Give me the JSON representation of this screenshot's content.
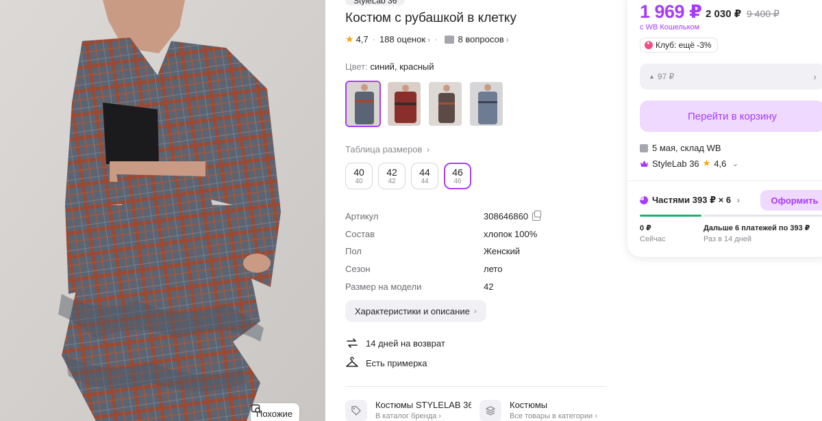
{
  "brand_chip": "StyleLab 36",
  "similar_label": "Похожие",
  "product": {
    "title": "Костюм с рубашкой в клетку",
    "rating": "4,7",
    "reviews": "188 оценок",
    "questions": "8 вопросов",
    "color_label": "Цвет:",
    "color_value": "синий, красный",
    "size_table": "Таблица размеров",
    "sizes": [
      {
        "main": "40",
        "sub": "40"
      },
      {
        "main": "42",
        "sub": "42"
      },
      {
        "main": "44",
        "sub": "44"
      },
      {
        "main": "46",
        "sub": "46"
      }
    ],
    "specs": [
      {
        "k": "Артикул",
        "v": "308646860"
      },
      {
        "k": "Состав",
        "v": "хлопок 100%"
      },
      {
        "k": "Пол",
        "v": "Женский"
      },
      {
        "k": "Сезон",
        "v": "лето"
      },
      {
        "k": "Размер на модели",
        "v": "42"
      }
    ],
    "desc_button": "Характеристики и описание",
    "perks": [
      "14 дней на возврат",
      "Есть примерка"
    ],
    "categories": [
      {
        "title": "Костюмы STYLELAB 36",
        "sub": "В каталог бренда"
      },
      {
        "title": "Костюмы",
        "sub": "Все товары в категории"
      }
    ]
  },
  "buy": {
    "price": "1 969 ₽",
    "price_2": "2 030 ₽",
    "price_old": "9 400 ₽",
    "wallet": "с WB Кошельком",
    "club": "Клуб: ещё -3%",
    "cashback": "97 ₽",
    "cart_button": "Перейти в корзину",
    "delivery": "5 мая, склад WB",
    "seller": "StyleLab 36",
    "seller_rating": "4,6",
    "parts": "Частями 393 ₽ × 6",
    "form_button": "Оформить",
    "pay_now_amount": "0 ₽",
    "pay_now_label": "Сейчас",
    "pay_later": "Дальше 6 платежей по 393 ₽",
    "pay_later_label": "Раз в 14 дней"
  },
  "colors": {
    "accent": "#a73afd",
    "accent_light": "#efd9fe",
    "star": "#f7a600",
    "progress": "#19b26b"
  }
}
